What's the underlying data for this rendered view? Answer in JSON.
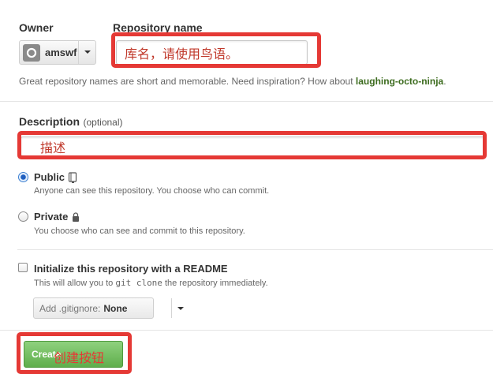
{
  "owner": {
    "label": "Owner",
    "name": "amswf"
  },
  "repository": {
    "label": "Repository name",
    "value": "库名，请使用鸟语。",
    "hint_text": "Great repository names are short and memorable. Need inspiration? How about",
    "hint_suggestion": "laughing-octo-ninja",
    "hint_end": "."
  },
  "description": {
    "label": "Description",
    "optional": "(optional)",
    "value": "描述"
  },
  "visibility": {
    "public_label": "Public",
    "public_note": "Anyone can see this repository. You choose who can commit.",
    "private_label": "Private",
    "private_note": "You choose who can see and commit to this repository."
  },
  "init": {
    "label": "Initialize this repository with a README",
    "note_before": "This will allow you to",
    "note_code": "git clone",
    "note_after": "the repository immediately."
  },
  "gitignore": {
    "label": "Add .gitignore:",
    "value": "None"
  },
  "create": {
    "button_label": "Create",
    "annotation": "创建按钮"
  },
  "colors": {
    "annotation_red": "#e53935",
    "button_green": "#5fae4c",
    "suggestion_green": "#3d6c1f"
  }
}
